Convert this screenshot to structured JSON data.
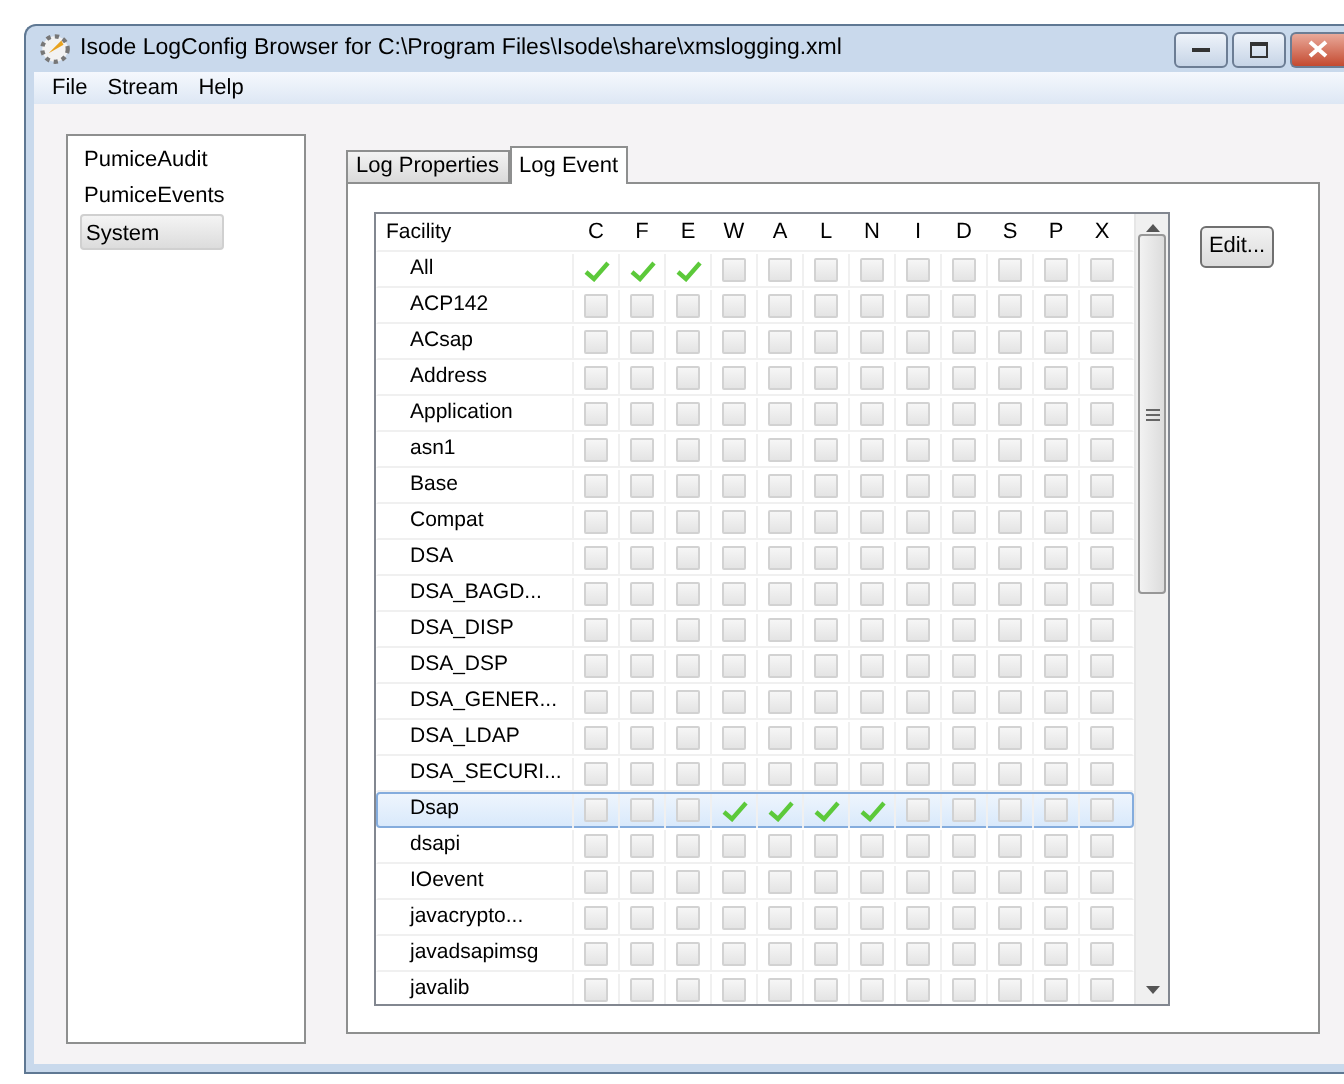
{
  "window": {
    "title": "Isode LogConfig Browser for C:\\Program Files\\Isode\\share\\xmslogging.xml"
  },
  "menu": [
    "File",
    "Stream",
    "Help"
  ],
  "streams": [
    {
      "label": "PumiceAudit",
      "selected": false
    },
    {
      "label": "PumiceEvents",
      "selected": false
    },
    {
      "label": "System",
      "selected": true
    }
  ],
  "tabs": [
    {
      "label": "Log Properties",
      "selected": false
    },
    {
      "label": "Log Event",
      "selected": true
    }
  ],
  "table": {
    "columns": [
      "Facility",
      "C",
      "F",
      "E",
      "W",
      "A",
      "L",
      "N",
      "I",
      "D",
      "S",
      "P",
      "X"
    ],
    "rows": [
      {
        "name": "All",
        "selected": false,
        "checks": [
          true,
          true,
          true,
          false,
          false,
          false,
          false,
          false,
          false,
          false,
          false,
          false
        ]
      },
      {
        "name": "ACP142",
        "selected": false,
        "checks": [
          false,
          false,
          false,
          false,
          false,
          false,
          false,
          false,
          false,
          false,
          false,
          false
        ]
      },
      {
        "name": "ACsap",
        "selected": false,
        "checks": [
          false,
          false,
          false,
          false,
          false,
          false,
          false,
          false,
          false,
          false,
          false,
          false
        ]
      },
      {
        "name": "Address",
        "selected": false,
        "checks": [
          false,
          false,
          false,
          false,
          false,
          false,
          false,
          false,
          false,
          false,
          false,
          false
        ]
      },
      {
        "name": "Application",
        "selected": false,
        "checks": [
          false,
          false,
          false,
          false,
          false,
          false,
          false,
          false,
          false,
          false,
          false,
          false
        ]
      },
      {
        "name": "asn1",
        "selected": false,
        "checks": [
          false,
          false,
          false,
          false,
          false,
          false,
          false,
          false,
          false,
          false,
          false,
          false
        ]
      },
      {
        "name": "Base",
        "selected": false,
        "checks": [
          false,
          false,
          false,
          false,
          false,
          false,
          false,
          false,
          false,
          false,
          false,
          false
        ]
      },
      {
        "name": "Compat",
        "selected": false,
        "checks": [
          false,
          false,
          false,
          false,
          false,
          false,
          false,
          false,
          false,
          false,
          false,
          false
        ]
      },
      {
        "name": "DSA",
        "selected": false,
        "checks": [
          false,
          false,
          false,
          false,
          false,
          false,
          false,
          false,
          false,
          false,
          false,
          false
        ]
      },
      {
        "name": "DSA_BAGD...",
        "selected": false,
        "checks": [
          false,
          false,
          false,
          false,
          false,
          false,
          false,
          false,
          false,
          false,
          false,
          false
        ]
      },
      {
        "name": "DSA_DISP",
        "selected": false,
        "checks": [
          false,
          false,
          false,
          false,
          false,
          false,
          false,
          false,
          false,
          false,
          false,
          false
        ]
      },
      {
        "name": "DSA_DSP",
        "selected": false,
        "checks": [
          false,
          false,
          false,
          false,
          false,
          false,
          false,
          false,
          false,
          false,
          false,
          false
        ]
      },
      {
        "name": "DSA_GENER...",
        "selected": false,
        "checks": [
          false,
          false,
          false,
          false,
          false,
          false,
          false,
          false,
          false,
          false,
          false,
          false
        ]
      },
      {
        "name": "DSA_LDAP",
        "selected": false,
        "checks": [
          false,
          false,
          false,
          false,
          false,
          false,
          false,
          false,
          false,
          false,
          false,
          false
        ]
      },
      {
        "name": "DSA_SECURI...",
        "selected": false,
        "checks": [
          false,
          false,
          false,
          false,
          false,
          false,
          false,
          false,
          false,
          false,
          false,
          false
        ]
      },
      {
        "name": "Dsap",
        "selected": true,
        "checks": [
          false,
          false,
          false,
          true,
          true,
          true,
          true,
          false,
          false,
          false,
          false,
          false
        ]
      },
      {
        "name": "dsapi",
        "selected": false,
        "checks": [
          false,
          false,
          false,
          false,
          false,
          false,
          false,
          false,
          false,
          false,
          false,
          false
        ]
      },
      {
        "name": "IOevent",
        "selected": false,
        "checks": [
          false,
          false,
          false,
          false,
          false,
          false,
          false,
          false,
          false,
          false,
          false,
          false
        ]
      },
      {
        "name": "javacrypto...",
        "selected": false,
        "checks": [
          false,
          false,
          false,
          false,
          false,
          false,
          false,
          false,
          false,
          false,
          false,
          false
        ]
      },
      {
        "name": "javadsapimsg",
        "selected": false,
        "checks": [
          false,
          false,
          false,
          false,
          false,
          false,
          false,
          false,
          false,
          false,
          false,
          false
        ]
      },
      {
        "name": "javalib",
        "selected": false,
        "checks": [
          false,
          false,
          false,
          false,
          false,
          false,
          false,
          false,
          false,
          false,
          false,
          false
        ]
      }
    ]
  },
  "edit_button": "Edit..."
}
